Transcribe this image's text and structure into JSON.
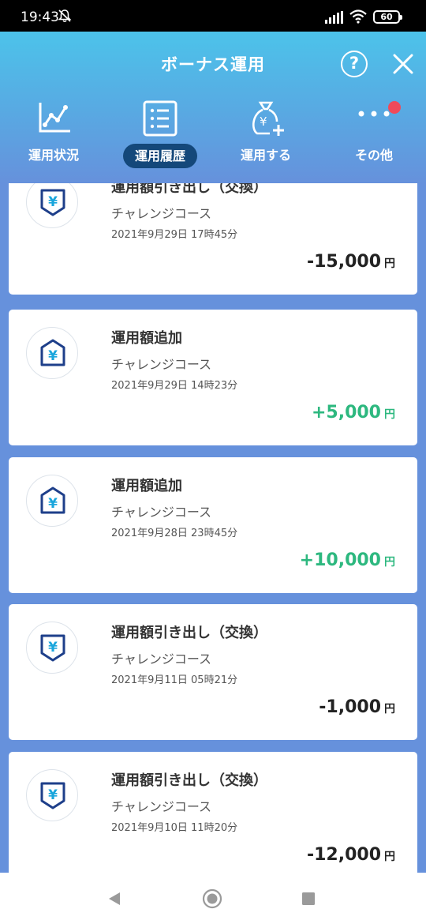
{
  "status_bar": {
    "time": "19:43",
    "battery": "60"
  },
  "header": {
    "title": "ボーナス運用",
    "help_label": "?"
  },
  "tabs": [
    {
      "label": "運用状況",
      "icon": "line-chart-icon"
    },
    {
      "label": "運用履歴",
      "icon": "list-icon",
      "active": true
    },
    {
      "label": "運用する",
      "icon": "money-bag-plus-icon"
    },
    {
      "label": "その他",
      "icon": "more-dots-icon",
      "notification": true
    }
  ],
  "transactions": [
    {
      "title": "運用額引き出し（交換）",
      "course": "チャレンジコース",
      "date": "2021年9月29日 17時45分",
      "amount": "-15,000",
      "currency": "円",
      "type": "withdraw"
    },
    {
      "title": "運用額追加",
      "course": "チャレンジコース",
      "date": "2021年9月29日 14時23分",
      "amount": "+5,000",
      "currency": "円",
      "type": "deposit"
    },
    {
      "title": "運用額追加",
      "course": "チャレンジコース",
      "date": "2021年9月28日 23時45分",
      "amount": "+10,000",
      "currency": "円",
      "type": "deposit"
    },
    {
      "title": "運用額引き出し（交換）",
      "course": "チャレンジコース",
      "date": "2021年9月11日 05時21分",
      "amount": "-1,000",
      "currency": "円",
      "type": "withdraw"
    },
    {
      "title": "運用額引き出し（交換）",
      "course": "チャレンジコース",
      "date": "2021年9月10日 11時20分",
      "amount": "-12,000",
      "currency": "円",
      "type": "withdraw"
    }
  ],
  "colors": {
    "accent_dark": "#14487a",
    "positive": "#2db87f",
    "badge_blue": "#1e3f8a",
    "yen_cyan": "#1aa6dc",
    "notification": "#f04a5a"
  }
}
